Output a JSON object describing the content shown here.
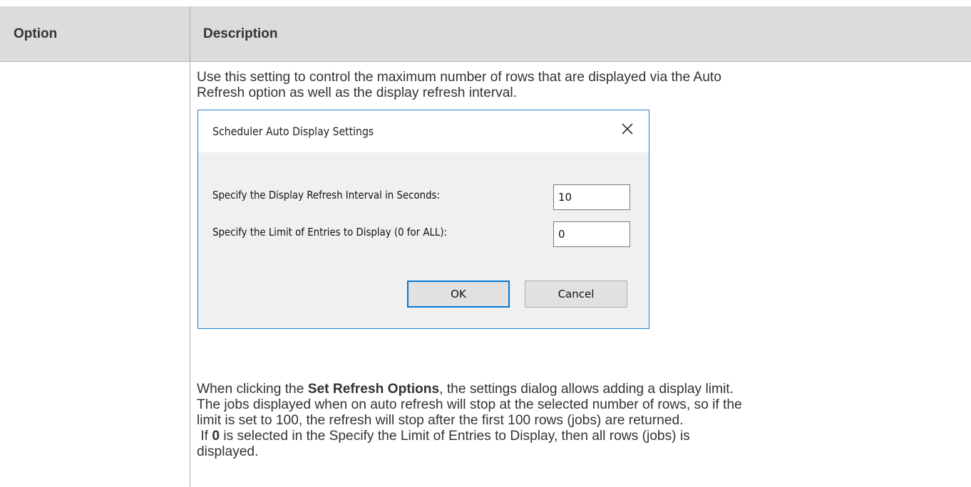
{
  "table": {
    "header": {
      "option": "Option",
      "description": "Description"
    },
    "row": {
      "intro_line1": "Use this setting to control the maximum number of rows that are displayed via the Auto",
      "intro_line2": "Refresh option as well as the display refresh interval.",
      "body_line1_prefix": "When clicking the ",
      "body_line1_bold": "Set Refresh Options",
      "body_line1_suffix": ", the settings dialog allows adding a display limit.",
      "body_line2": "The jobs displayed when on auto refresh will stop at the selected number of rows, so if the",
      "body_line3": "limit is set to 100, the refresh will stop after the first 100 rows (jobs) are returned.",
      "body_line4_prefix": " If ",
      "body_line4_bold": "0",
      "body_line4_suffix": " is selected in the Specify the Limit of Entries to Display, then all rows (jobs) is",
      "body_line5": "displayed."
    }
  },
  "dialog": {
    "title": "Scheduler Auto Display Settings",
    "close_icon": "close-icon",
    "interval_label": "Specify the Display Refresh Interval in Seconds:",
    "interval_value": "10",
    "limit_label": "Specify the Limit of Entries to Display (0 for ALL):",
    "limit_value": "0",
    "ok_label": "OK",
    "cancel_label": "Cancel"
  },
  "colors": {
    "header_background": "#dcdcdc",
    "dialog_border": "#1e7fd1",
    "dialog_background": "#f0f0f0",
    "default_button_border": "#0078d7"
  }
}
